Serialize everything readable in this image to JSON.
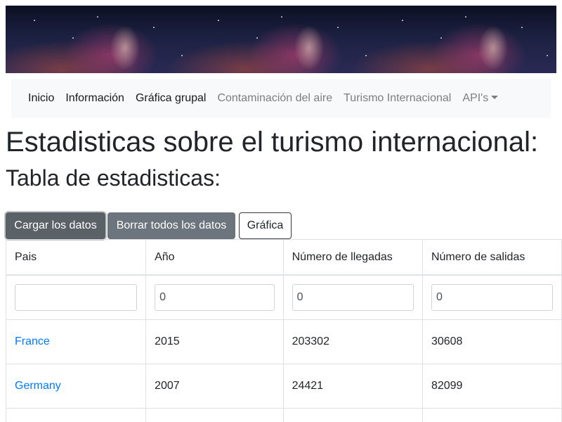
{
  "banner": {
    "alt": "starry night sky banner"
  },
  "nav": {
    "items": [
      {
        "label": "Inicio",
        "active": true
      },
      {
        "label": "Información",
        "active": true
      },
      {
        "label": "Gráfica grupal",
        "active": true
      },
      {
        "label": "Contaminación del aire",
        "active": false
      },
      {
        "label": "Turismo Internacional",
        "active": false
      },
      {
        "label": "API's",
        "active": false,
        "dropdown": true
      }
    ]
  },
  "page": {
    "title": "Estadisticas sobre el turismo internacional:",
    "subtitle": "Tabla de estadisticas:"
  },
  "toolbar": {
    "load_label": "Cargar los datos",
    "delete_label": "Borrar todos los datos",
    "chart_label": "Gráfica"
  },
  "table": {
    "headers": [
      "Pais",
      "Año",
      "Número de llegadas",
      "Número de salidas"
    ],
    "filters": [
      "",
      "0",
      "0",
      "0"
    ],
    "rows": [
      [
        "France",
        "2015",
        "203302",
        "30608"
      ],
      [
        "Germany",
        "2007",
        "24421",
        "82099"
      ]
    ]
  },
  "colors": {
    "link": "#007bff",
    "button_dark": "#6c757d",
    "navbar_bg": "#f8f9fa"
  }
}
